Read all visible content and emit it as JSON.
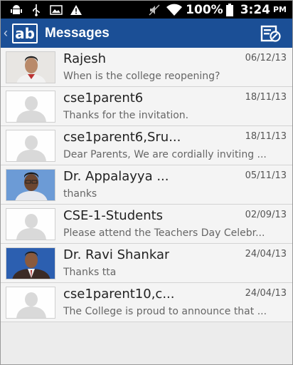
{
  "status_bar": {
    "battery": "100%",
    "time": "3:24",
    "ampm": "PM"
  },
  "app_bar": {
    "logo": "ab",
    "title": "Messages"
  },
  "messages": [
    {
      "name": "Rajesh",
      "date": "06/12/13",
      "preview": "When is the college reopening?",
      "avatar": "photo-young-man"
    },
    {
      "name": "cse1parent6",
      "date": "18/11/13",
      "preview": "Thanks for the invitation.",
      "avatar": "placeholder"
    },
    {
      "name": "cse1parent6,Sru...",
      "date": "18/11/13",
      "preview": "Dear Parents, We are cordially inviting ...",
      "avatar": "placeholder"
    },
    {
      "name": "Dr. Appalayya ...",
      "date": "05/11/13",
      "preview": "thanks",
      "avatar": "photo-man-glasses"
    },
    {
      "name": "CSE-1-Students",
      "date": "02/09/13",
      "preview": "Please attend the Teachers Day Celebr...",
      "avatar": "placeholder"
    },
    {
      "name": "Dr. Ravi Shankar",
      "date": "24/04/13",
      "preview": "Thanks tta",
      "avatar": "photo-man-suit"
    },
    {
      "name": "cse1parent10,c...",
      "date": "24/04/13",
      "preview": "The College is proud to announce that ...",
      "avatar": "placeholder"
    }
  ],
  "colors": {
    "app_bar": "#1b4f96",
    "status_bar": "#000000",
    "list_bg": "#f4f4f4"
  }
}
